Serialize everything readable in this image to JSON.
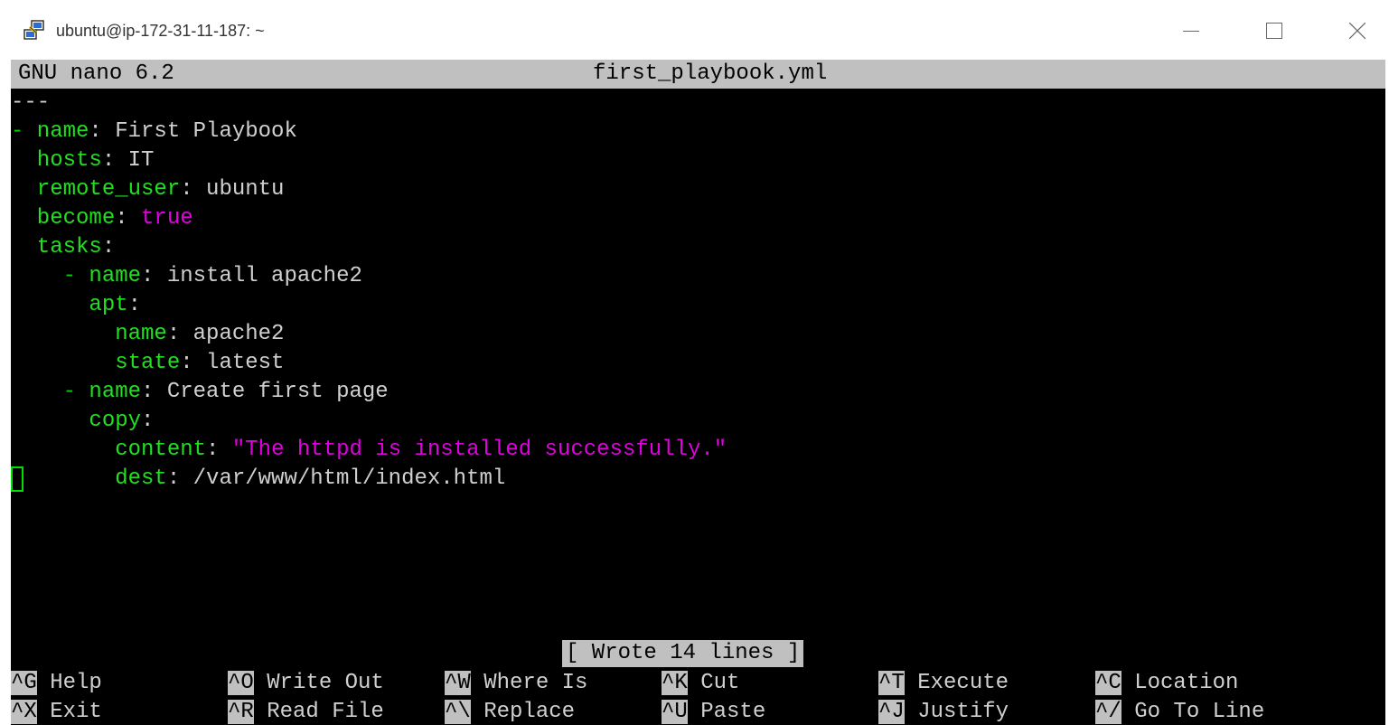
{
  "window": {
    "title": "ubuntu@ip-172-31-11-187: ~"
  },
  "editor": {
    "app": "GNU nano 6.2",
    "filename": "first_playbook.yml",
    "status_message": "[ Wrote 14 lines ]",
    "lines": [
      [
        {
          "t": "---",
          "c": "txt"
        }
      ],
      [
        {
          "t": "-",
          "c": "dash"
        },
        {
          "t": " name",
          "c": "key"
        },
        {
          "t": ": First Playbook",
          "c": "txt"
        }
      ],
      [
        {
          "t": "  hosts",
          "c": "key"
        },
        {
          "t": ": IT",
          "c": "txt"
        }
      ],
      [
        {
          "t": "  remote_user",
          "c": "key"
        },
        {
          "t": ": ubuntu",
          "c": "txt"
        }
      ],
      [
        {
          "t": "  become",
          "c": "key"
        },
        {
          "t": ": ",
          "c": "txt"
        },
        {
          "t": "true",
          "c": "kw"
        }
      ],
      [
        {
          "t": "  tasks",
          "c": "key"
        },
        {
          "t": ":",
          "c": "txt"
        }
      ],
      [
        {
          "t": "    -",
          "c": "dash"
        },
        {
          "t": " name",
          "c": "key"
        },
        {
          "t": ": install apache2",
          "c": "txt"
        }
      ],
      [
        {
          "t": "      apt",
          "c": "key"
        },
        {
          "t": ":",
          "c": "txt"
        }
      ],
      [
        {
          "t": "        name",
          "c": "key"
        },
        {
          "t": ": apache2",
          "c": "txt"
        }
      ],
      [
        {
          "t": "        state",
          "c": "key"
        },
        {
          "t": ": latest",
          "c": "txt"
        }
      ],
      [
        {
          "t": "    -",
          "c": "dash"
        },
        {
          "t": " name",
          "c": "key"
        },
        {
          "t": ": Create first page",
          "c": "txt"
        }
      ],
      [
        {
          "t": "      copy",
          "c": "key"
        },
        {
          "t": ":",
          "c": "txt"
        }
      ],
      [
        {
          "t": "        content",
          "c": "key"
        },
        {
          "t": ": ",
          "c": "txt"
        },
        {
          "t": "\"The httpd is installed successfully.\"",
          "c": "str"
        }
      ],
      [
        {
          "t": "        dest",
          "c": "key"
        },
        {
          "t": ": /var/www/html/index.html",
          "c": "txt"
        }
      ]
    ],
    "shortcuts_row1": [
      {
        "key": "^G",
        "label": "Help"
      },
      {
        "key": "^O",
        "label": "Write Out"
      },
      {
        "key": "^W",
        "label": "Where Is"
      },
      {
        "key": "^K",
        "label": "Cut"
      },
      {
        "key": "^T",
        "label": "Execute"
      },
      {
        "key": "^C",
        "label": "Location"
      }
    ],
    "shortcuts_row2": [
      {
        "key": "^X",
        "label": "Exit"
      },
      {
        "key": "^R",
        "label": "Read File"
      },
      {
        "key": "^\\",
        "label": "Replace"
      },
      {
        "key": "^U",
        "label": "Paste"
      },
      {
        "key": "^J",
        "label": "Justify"
      },
      {
        "key": "^/",
        "label": "Go To Line"
      }
    ]
  },
  "colors": {
    "key": "#20e020",
    "string": "#e000e0",
    "text": "#d0d0d0",
    "header_bg": "#c0c0c0",
    "cursor": "#00e000"
  },
  "icons": {
    "app": "putty-icon",
    "minimize": "minimize-icon",
    "maximize": "maximize-icon",
    "close": "close-icon"
  }
}
